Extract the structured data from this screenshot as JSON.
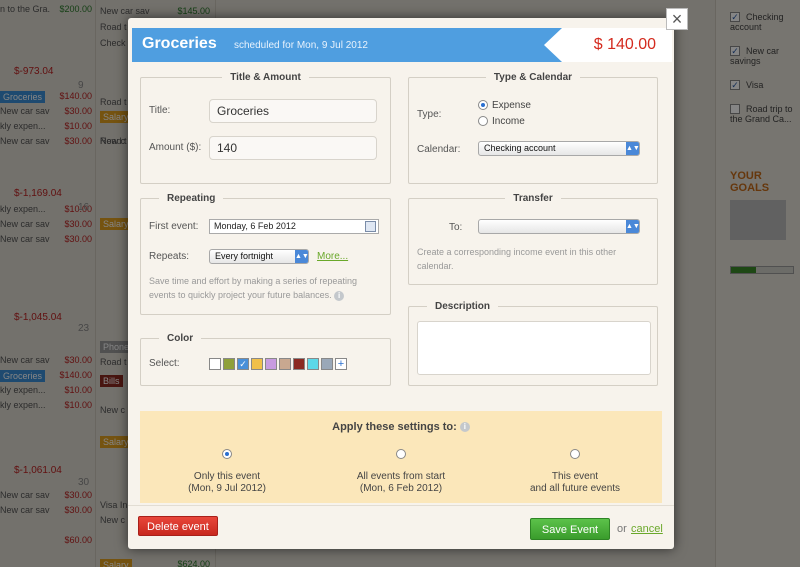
{
  "background": {
    "col1": [
      {
        "text": "n to the Gra...",
        "amount": "$200.00",
        "cls": "pos"
      },
      {
        "text": "Groceries",
        "amount": "$140.00",
        "cls": "neg",
        "tag": "tag-blue"
      },
      {
        "text": "New car savin...",
        "amount": "$30.00",
        "cls": "neg"
      },
      {
        "text": "kly expen...",
        "amount": "$10.00",
        "cls": "neg"
      },
      {
        "text": "New car savin...",
        "amount": "$30.00",
        "cls": "neg"
      },
      {
        "text": "kly expen...",
        "amount": "$10.00",
        "cls": "neg"
      },
      {
        "text": "New car savin...",
        "amount": "$30.00",
        "cls": "neg"
      },
      {
        "text": "New car savin...",
        "amount": "$30.00",
        "cls": "neg"
      },
      {
        "text": "Groceries",
        "amount": "$140.00",
        "cls": "neg",
        "tag": "tag-blue"
      },
      {
        "text": "New car savin...",
        "amount": "$30.00",
        "cls": "neg"
      },
      {
        "text": "kly expen...",
        "amount": "$10.00",
        "cls": "neg"
      },
      {
        "text": "kly expen...",
        "amount": "$10.00",
        "cls": "neg"
      },
      {
        "text": "New car savin...",
        "amount": "$30.00",
        "cls": "neg"
      },
      {
        "text": "New car savin...",
        "amount": "$30.00",
        "cls": "neg"
      },
      {
        "text": "",
        "amount": "$60.00",
        "cls": "neg"
      }
    ],
    "col1_balances": [
      "$-973.04",
      "$-1,169.04",
      "$-1,045.04",
      "$-1,061.04"
    ],
    "col1_days": [
      "9",
      "16",
      "23",
      "30"
    ],
    "col2": [
      {
        "text": "New car savin...",
        "amount": "$145.00",
        "cls": "pos"
      },
      {
        "text": "Road t",
        "tag": "",
        "amount": ""
      },
      {
        "text": "Check",
        "amount": ""
      },
      {
        "text": "Road t",
        "amount": ""
      },
      {
        "text": "Salary",
        "tag": "tag-orange",
        "amount": ""
      },
      {
        "text": "New c",
        "amount": ""
      },
      {
        "text": "Road t",
        "amount": ""
      },
      {
        "text": "Salary",
        "tag": "tag-orange",
        "amount": ""
      },
      {
        "text": "Phone",
        "tag": "tag-grey",
        "amount": ""
      },
      {
        "text": "Road t",
        "amount": ""
      },
      {
        "text": "Bills",
        "tag": "tag-red",
        "amount": ""
      },
      {
        "text": "New c",
        "amount": ""
      },
      {
        "text": "Salary",
        "tag": "tag-orange",
        "amount": ""
      },
      {
        "text": "Visa In",
        "amount": ""
      },
      {
        "text": "New c",
        "amount": ""
      },
      {
        "text": "Salary",
        "tag": "tag-orange",
        "amount": "$624.00"
      }
    ],
    "right_panel": {
      "items": [
        "Checking account",
        "New car savings",
        "Visa",
        "Road trip to the Grand Ca..."
      ],
      "goals_title": "YOUR GOALS"
    }
  },
  "dialog": {
    "title": "Groceries",
    "subtitle": "scheduled for Mon, 9 Jul 2012",
    "amount_display": "$ 140.00",
    "close_label": "×",
    "title_amount": {
      "legend": "Title & Amount",
      "title_label": "Title:",
      "title_value": "Groceries",
      "amount_label": "Amount ($):",
      "amount_value": "140"
    },
    "type_calendar": {
      "legend": "Type & Calendar",
      "type_label": "Type:",
      "expense_label": "Expense",
      "income_label": "Income",
      "selected_type": "Expense",
      "calendar_label": "Calendar:",
      "calendar_value": "Checking account"
    },
    "repeating": {
      "legend": "Repeating",
      "first_event_label": "First event:",
      "first_event_value": "Monday,  6 Feb 2012",
      "repeats_label": "Repeats:",
      "repeats_value": "Every fortnight",
      "more_link": "More...",
      "help_text": "Save time and effort by making a series of repeating events to quickly project your future balances."
    },
    "transfer": {
      "legend": "Transfer",
      "to_label": "To:",
      "to_value": "",
      "help_text": "Create a corresponding income event in this other calendar."
    },
    "color": {
      "legend": "Color",
      "select_label": "Select:",
      "swatches": [
        "#ffffff",
        "#8fa03a",
        "#4a90d9",
        "#f0c04a",
        "#c79be0",
        "#c8a890",
        "#8b2a22",
        "#5cd8e8",
        "#9aa8b8"
      ],
      "selected_index": 2,
      "add_label": "+"
    },
    "description": {
      "legend": "Description",
      "value": ""
    },
    "apply": {
      "title": "Apply these settings to:",
      "options": [
        {
          "line1": "Only this event",
          "line2": "(Mon, 9 Jul 2012)",
          "selected": true
        },
        {
          "line1": "All events from start",
          "line2": "(Mon, 6 Feb 2012)",
          "selected": false
        },
        {
          "line1": "This event",
          "line2": "and all future events",
          "selected": false
        }
      ]
    },
    "footer": {
      "delete_label": "Delete event",
      "save_label": "Save Event",
      "or_label": "or",
      "cancel_label": "cancel"
    }
  }
}
